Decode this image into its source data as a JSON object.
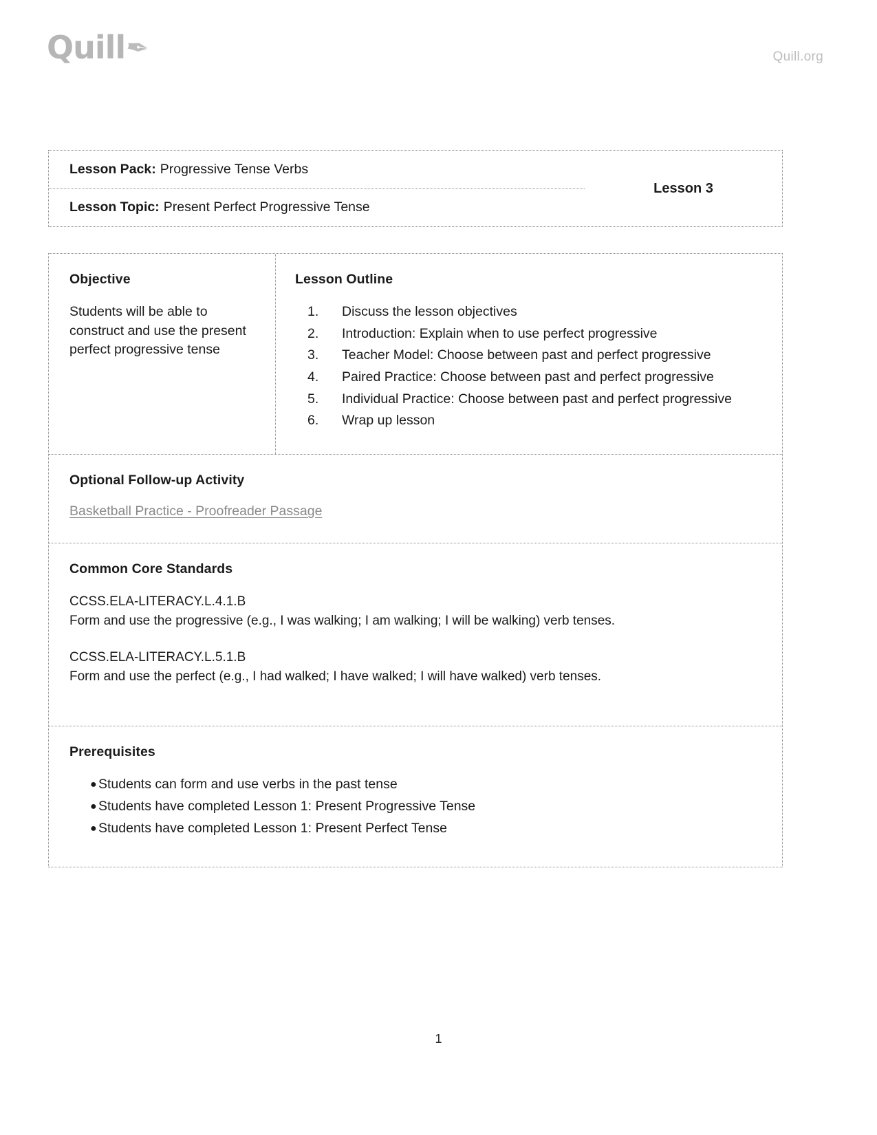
{
  "header": {
    "logo_text": "Quill",
    "logo_icon": "feather-icon",
    "site_label": "Quill.org"
  },
  "identity": {
    "pack_label": "Lesson Pack:",
    "pack_value": "Progressive Tense Verbs",
    "topic_label": "Lesson Topic:",
    "topic_value": "Present Perfect Progressive Tense",
    "lesson_number": "Lesson 3"
  },
  "objective": {
    "heading": "Objective",
    "body": "Students will be able to construct and use the present perfect progressive tense"
  },
  "outline": {
    "heading": "Lesson Outline",
    "items": [
      {
        "num": "1.",
        "text": "Discuss the lesson objectives"
      },
      {
        "num": "2.",
        "text": "Introduction: Explain when to use perfect progressive"
      },
      {
        "num": "3.",
        "text": "Teacher Model: Choose between past and perfect progressive"
      },
      {
        "num": "4.",
        "text": "Paired Practice: Choose between past and perfect progressive"
      },
      {
        "num": "5.",
        "text": "Individual Practice: Choose between past and perfect progressive"
      },
      {
        "num": "6.",
        "text": "Wrap up lesson"
      }
    ]
  },
  "followup": {
    "heading": "Optional Follow-up Activity",
    "link_text": "Basketball Practice - Proofreader Passage"
  },
  "standards": {
    "heading": "Common Core Standards",
    "items": [
      {
        "code": "CCSS.ELA-LITERACY.L.4.1.B",
        "description": "Form and use the progressive (e.g., I was walking; I am walking; I will be walking) verb tenses."
      },
      {
        "code": "CCSS.ELA-LITERACY.L.5.1.B",
        "description": "Form and use the perfect (e.g., I had walked; I have walked; I will have walked) verb tenses."
      }
    ]
  },
  "prerequisites": {
    "heading": "Prerequisites",
    "bullet_glyph": "●",
    "items": [
      "Students can form and use verbs in the past tense",
      "Students have completed Lesson 1: Present Progressive Tense",
      "Students have completed Lesson 1: Present Perfect Tense"
    ]
  },
  "footer": {
    "page_number": "1"
  }
}
